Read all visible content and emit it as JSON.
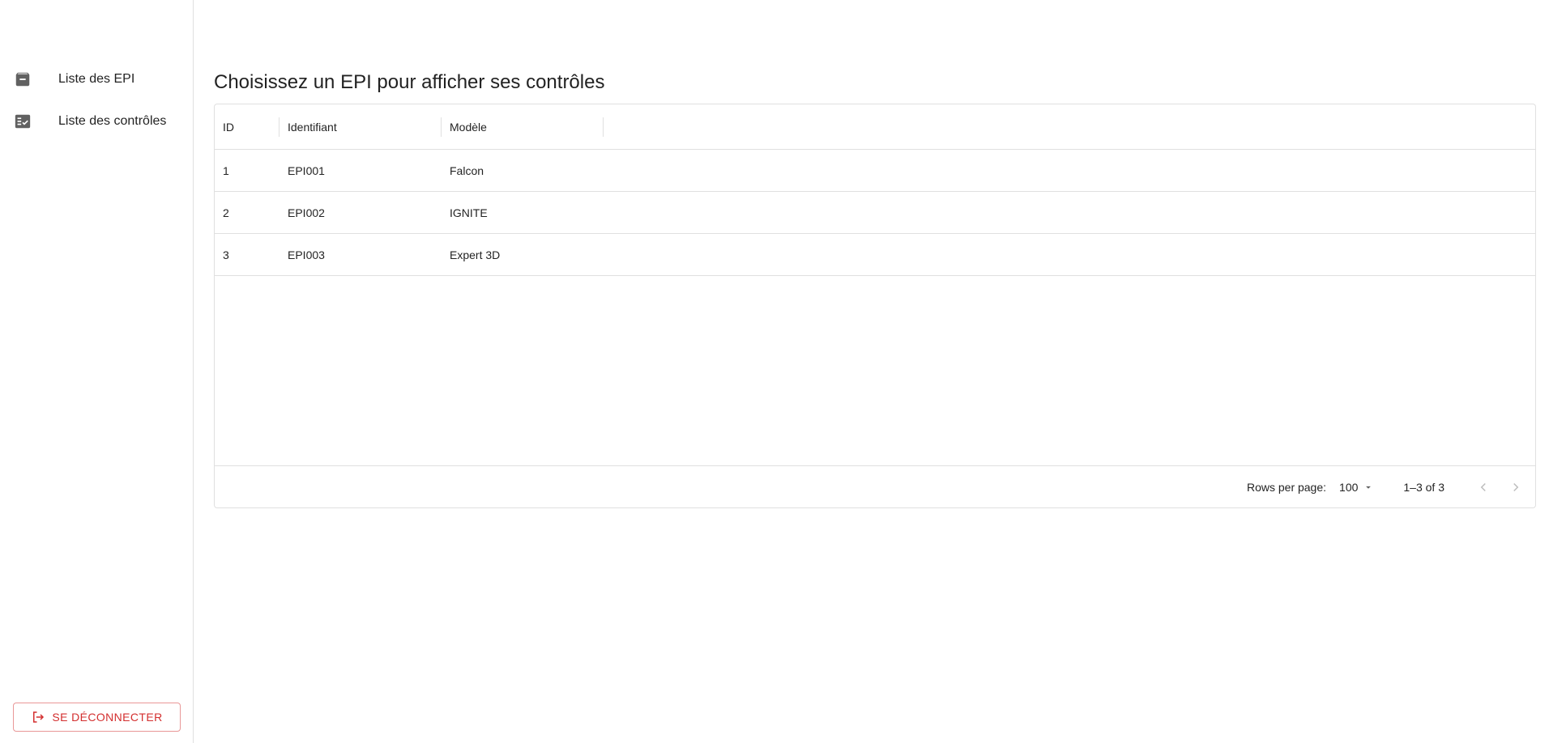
{
  "sidebar": {
    "items": [
      {
        "label": "Liste des EPI",
        "icon": "archive-icon"
      },
      {
        "label": "Liste des contrôles",
        "icon": "fact-check-icon"
      }
    ],
    "logout_label": "SE DÉCONNECTER"
  },
  "main": {
    "title": "Choisissez un EPI pour afficher ses contrôles",
    "table": {
      "columns": [
        "ID",
        "Identifiant",
        "Modèle"
      ],
      "rows": [
        [
          "1",
          "EPI001",
          "Falcon"
        ],
        [
          "2",
          "EPI002",
          "IGNITE"
        ],
        [
          "3",
          "EPI003",
          "Expert 3D"
        ]
      ],
      "footer": {
        "rows_per_page_label": "Rows per page:",
        "rows_per_page_value": "100",
        "range": "1–3 of 3"
      }
    }
  },
  "colors": {
    "danger": "#d32f2f",
    "border": "#e0e0e0",
    "icon": "#616161"
  }
}
